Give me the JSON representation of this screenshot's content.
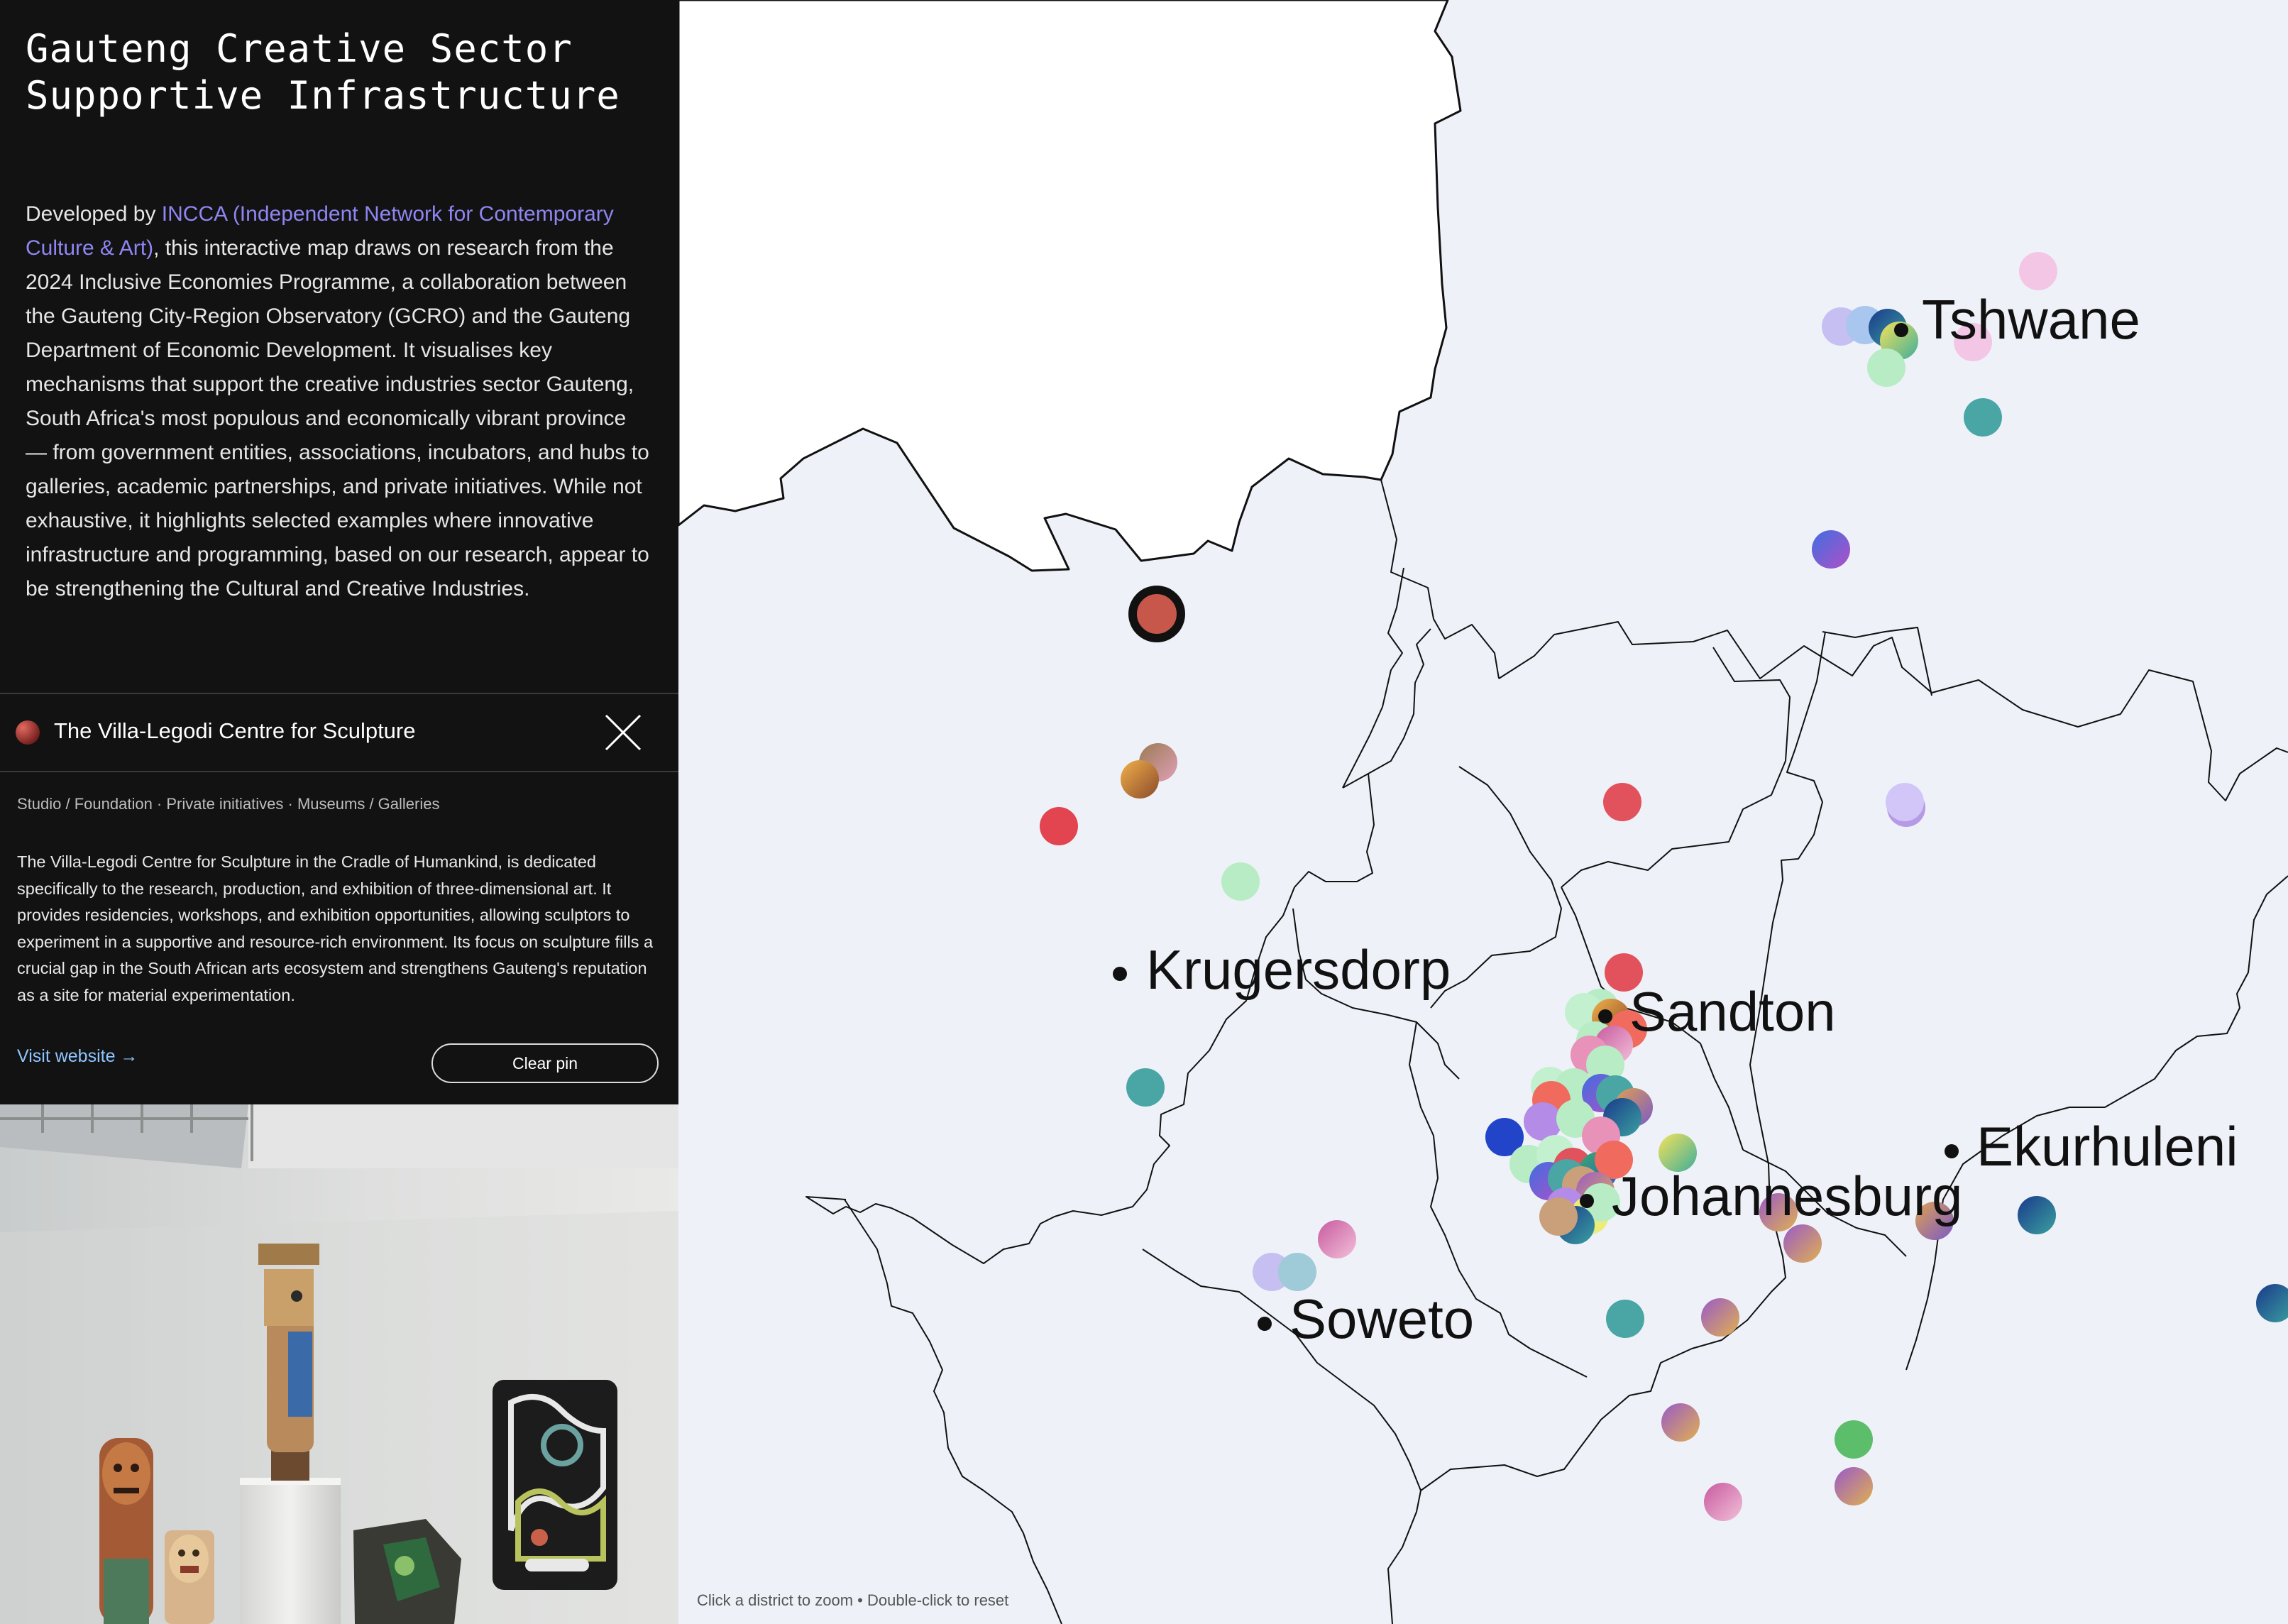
{
  "sidebar": {
    "title_line1": "Gauteng Creative Sector",
    "title_line2": "Supportive Infrastructure",
    "intro_prefix": "Developed by ",
    "intro_link": "INCCA (Independent Network for Contemporary Culture & Art)",
    "intro_body": ", this interactive map draws on research from the 2024 Inclusive Economies Programme, a collaboration between the Gauteng City-Region Observatory (GCRO) and the Gauteng Department of Economic Development. It visualises key mechanisms that support the creative industries sector Gauteng, South Africa's most populous and economically vibrant province — from government entities, associations, incubators, and hubs to galleries, academic partnerships, and private initiatives. While not exhaustive, it highlights selected examples where innovative infrastructure and programming, based on our research, appear to be strengthening the Cultural and Creative Industries."
  },
  "pin": {
    "name": "The Villa-Legodi Centre for Sculpture",
    "tags": "Studio / Foundation · Private initiatives · Museums / Galleries",
    "description": "The Villa-Legodi Centre for Sculpture in the Cradle of Humankind, is dedicated specifically to the research, production, and exhibition of three-dimensional art. It provides residencies, workshops, and exhibition opportunities, allowing sculptors to experiment in a supportive and resource-rich environment. Its focus on sculpture fills a crucial gap in the South African arts ecosystem and strengthens Gauteng's reputation as a site for material experimentation.",
    "visit_label": "Visit website →",
    "clear_label": "Clear pin",
    "close_icon": "close-icon",
    "color": "#c7564b"
  },
  "map": {
    "cities": [
      {
        "name": "Tshwane"
      },
      {
        "name": "Krugersdorp"
      },
      {
        "name": "Sandton"
      },
      {
        "name": "Ekurhuleni"
      },
      {
        "name": "Johannesburg"
      },
      {
        "name": "Soweto"
      }
    ],
    "hint": "Click a district to zoom • Double-click to reset",
    "colors": {
      "land": "#eef2f8",
      "outside": "#ffffff",
      "border": "#111111",
      "selected_pin": "#c7564b"
    }
  }
}
